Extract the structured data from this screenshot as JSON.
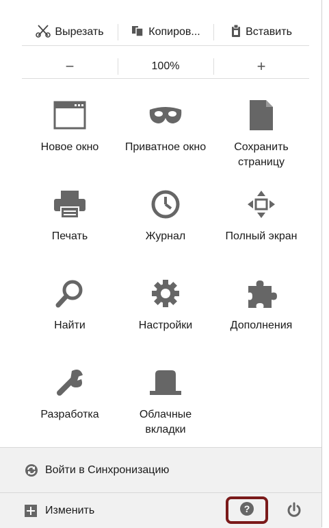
{
  "edit": {
    "cut_label": "Вырезать",
    "copy_label": "Копиров...",
    "paste_label": "Вставить"
  },
  "zoom": {
    "minus": "−",
    "level": "100%",
    "plus": "+"
  },
  "tools": [
    {
      "label": "Новое окно",
      "icon": "new-window-icon"
    },
    {
      "label": "Приватное окно",
      "icon": "private-mask-icon"
    },
    {
      "label": "Сохранить страницу",
      "icon": "save-page-icon"
    },
    {
      "label": "Печать",
      "icon": "printer-icon"
    },
    {
      "label": "Журнал",
      "icon": "history-clock-icon"
    },
    {
      "label": "Полный экран",
      "icon": "fullscreen-icon"
    },
    {
      "label": "Найти",
      "icon": "search-icon"
    },
    {
      "label": "Настройки",
      "icon": "gear-icon"
    },
    {
      "label": "Дополнения",
      "icon": "puzzle-icon"
    },
    {
      "label": "Разработка",
      "icon": "wrench-icon"
    },
    {
      "label": "Облачные вкладки",
      "icon": "cloud-tabs-icon"
    }
  ],
  "footer": {
    "sync_label": "Войти в Синхронизацию",
    "customize_label": "Изменить",
    "help_icon": "help-icon",
    "quit_icon": "power-icon"
  },
  "colors": {
    "icon_gray": "#666666",
    "footer_bg": "#f1f1f1",
    "help_highlight": "#7a1a1a"
  }
}
